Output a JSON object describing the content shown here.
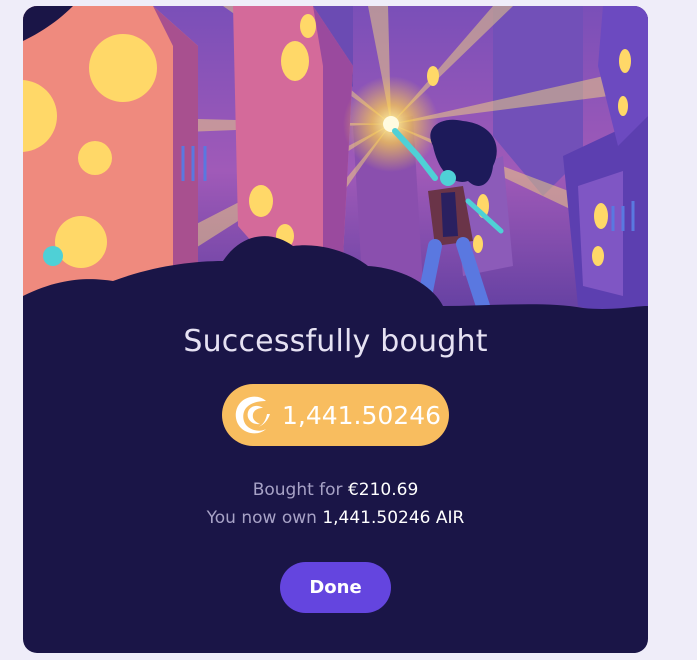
{
  "dialog": {
    "title": "Successfully bought",
    "amount": "1,441.50246",
    "coin_icon": "air-token-icon",
    "bought_prefix": "Bought for",
    "bought_value": "€210.69",
    "own_prefix": "You now own",
    "own_value": "1,441.50246 AIR",
    "done_label": "Done"
  },
  "colors": {
    "page_bg": "#efedf9",
    "card_bg": "#1a1547",
    "pill_bg": "#f8bd5f",
    "button_bg": "#6445df"
  }
}
